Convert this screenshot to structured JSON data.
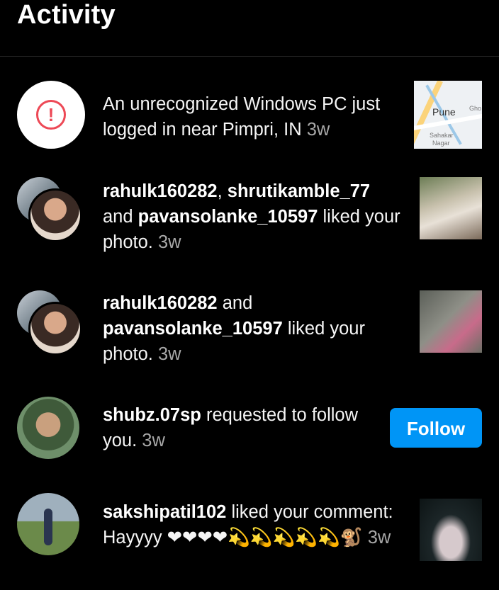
{
  "header": {
    "title": "Activity"
  },
  "notifications": [
    {
      "text": "An unrecognized Windows PC just logged in near Pimpri, IN",
      "time": "3w",
      "icon": "alert-icon",
      "thumb": {
        "type": "map",
        "labels": [
          "Pune",
          "Gho",
          "Sahakar",
          "Nagar"
        ]
      }
    },
    {
      "user1": "rahulk160282",
      "sep1": ", ",
      "user2": "shrutikamble_77",
      "sep2": " and ",
      "user3": "pavansolanke_10597",
      "action": " liked your photo.",
      "time": "3w"
    },
    {
      "user1": "rahulk160282",
      "sep1": " and ",
      "user2": "pavansolanke_10597",
      "action": " liked your photo.",
      "time": "3w"
    },
    {
      "user1": "shubz.07sp",
      "action": " requested to follow you.",
      "time": "3w",
      "button": "Follow"
    },
    {
      "user1": "sakshipatil102",
      "action": " liked your comment: Hayyyy ❤❤❤❤💫💫💫💫💫🐒",
      "time": "3w"
    }
  ],
  "colors": {
    "accent": "#0095f6",
    "alert": "#ed4956",
    "timestamp": "#a8a8a8"
  }
}
